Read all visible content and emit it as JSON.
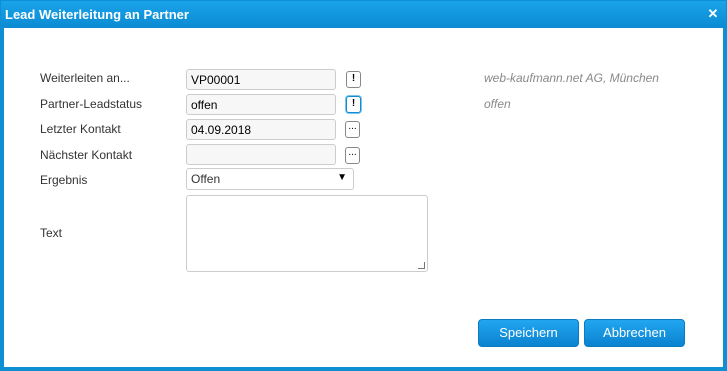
{
  "window": {
    "title": "Lead Weiterleitung an Partner",
    "close_icon": "close-icon"
  },
  "form": {
    "forward_label": "Weiterleiten an...",
    "forward_value": "VP00001",
    "forward_info": "web-kaufmann.net AG, München",
    "status_label": "Partner-Leadstatus",
    "status_value": "offen",
    "status_info": "offen",
    "last_contact_label": "Letzter Kontakt",
    "last_contact_value": "04.09.2018",
    "next_contact_label": "Nächster Kontakt",
    "next_contact_value": "",
    "result_label": "Ergebnis",
    "result_value": "Offen",
    "text_label": "Text",
    "text_value": "",
    "alert_glyph": "!",
    "picker_glyph": "...",
    "dropdown_glyph": "▼"
  },
  "buttons": {
    "save_label": "Speichern",
    "cancel_label": "Abbrechen"
  },
  "colors": {
    "accent": "#0e8fd4",
    "button": "#1496e0",
    "info_text": "#888888"
  }
}
